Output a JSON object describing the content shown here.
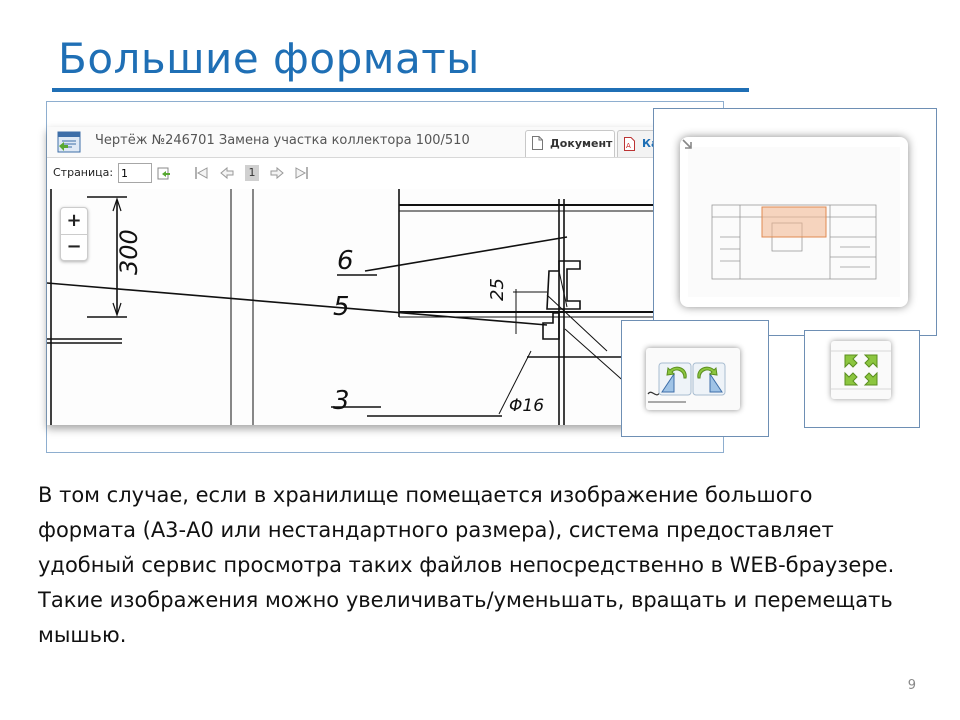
{
  "slide": {
    "title": "Большие форматы",
    "body": "В том случае, если в хранилище помещается изображение большого формата (А3-А0 или нестандартного размера), система предоставляет удобный сервис просмотра таких файлов непосредственно в WEB-браузере.  Такие изображения можно увеличивать/уменьшать, вращать и перемещать мышью.",
    "page_number": "9",
    "accent_color": "#1f6fb5"
  },
  "viewer": {
    "window_title": "Чертёж №246701 Замена участка коллектора 100/510",
    "tabs": [
      {
        "label": "Документ",
        "active": true
      },
      {
        "label": "Ка",
        "active": false
      }
    ],
    "toolbar": {
      "page_label": "Страница:",
      "page_input_value": "1",
      "current_page": "1"
    },
    "zoom": {
      "in": "+",
      "out": "−"
    },
    "drawing_labels": {
      "dim_300": "300",
      "dim_25": "25",
      "phi16": "Φ16",
      "mark_6": "6",
      "mark_5": "5",
      "mark_3": "3"
    }
  },
  "icons": {
    "document": "document-icon",
    "pdf": "pdf-icon",
    "go": "go-to-page-icon",
    "first": "first-page-icon",
    "prev": "previous-page-icon",
    "next": "next-page-icon",
    "last": "last-page-icon",
    "resize": "resize-icon",
    "rotate_left": "rotate-left-icon",
    "rotate_right": "rotate-right-icon",
    "fullscreen": "fullscreen-icon"
  }
}
